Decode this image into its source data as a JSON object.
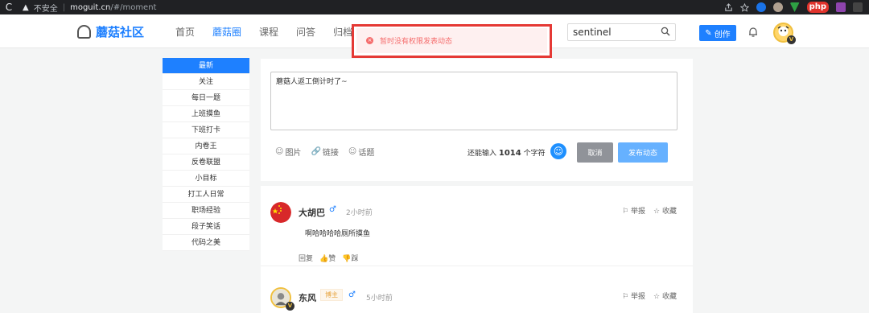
{
  "browser": {
    "reload": "C",
    "warning": "▲",
    "insecure": "不安全",
    "sep": "|",
    "url_host": "moguit.cn",
    "url_path": "/#/moment",
    "php": "php"
  },
  "header": {
    "logo_text": "蘑菇社区",
    "nav": [
      "首页",
      "蘑菇圈",
      "课程",
      "问答",
      "归档"
    ],
    "active_nav": "蘑菇圈",
    "search_value": "sentinel",
    "create_label": "创作",
    "avatar_badge": "V"
  },
  "toast": {
    "icon": "×",
    "message": "暂时没有权限发表动态"
  },
  "sidebar": {
    "items": [
      "最新",
      "关注",
      "每日一题",
      "上班摸鱼",
      "下班打卡",
      "内卷王",
      "反卷联盟",
      "小目标",
      "打工人日常",
      "职场经验",
      "段子笑话",
      "代码之美"
    ],
    "active_index": 0
  },
  "compose": {
    "text": "蘑菇人返工倒计时了~",
    "tools": [
      {
        "icon": "☺",
        "label": "图片"
      },
      {
        "icon": "🔗",
        "label": "链接"
      },
      {
        "icon": "☺",
        "label": "话题"
      }
    ],
    "counter_prefix": "还能输入",
    "counter_value": "1014",
    "counter_suffix": "个字符",
    "emoji": "☺",
    "cancel_label": "取消",
    "publish_label": "发布动态"
  },
  "posts": [
    {
      "name": "大胡巴",
      "gender": "♂",
      "time": "2小时前",
      "content": "啊哈哈哈哈厕所摸鱼",
      "report": "举报",
      "collect": "收藏",
      "reply": "回复",
      "like": "赞",
      "dislike": "踩"
    },
    {
      "name": "东风",
      "tag": "博主",
      "gender": "♂",
      "time": "5小时前",
      "report": "举报",
      "collect": "收藏",
      "avatar_badge": "V"
    }
  ],
  "colors": {
    "accent": "#1e80ff",
    "toast_border": "#e53935",
    "toast_text": "#f56c6c",
    "cancel": "#909399",
    "publish": "#66b1ff"
  }
}
